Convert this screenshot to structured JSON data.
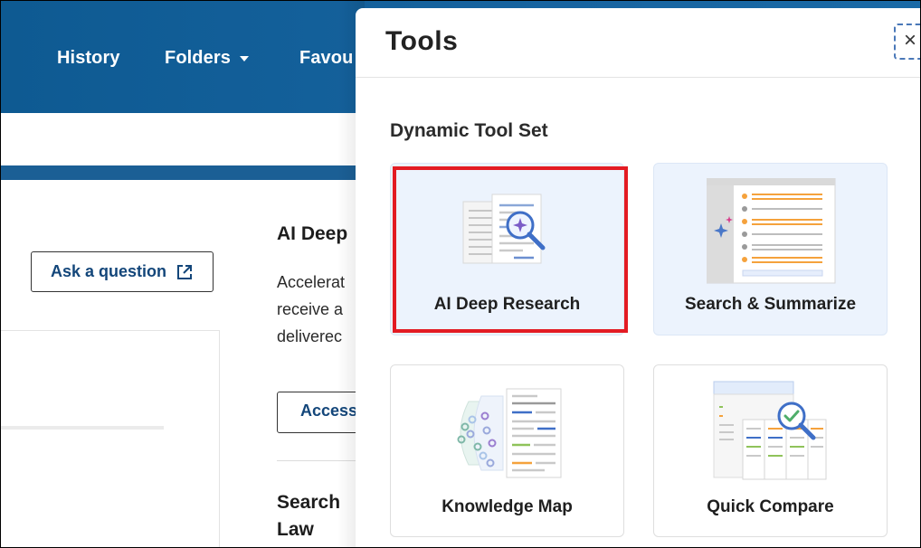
{
  "nav": {
    "history": "History",
    "folders": "Folders",
    "favourites": "Favou"
  },
  "background": {
    "ask_button": "Ask a question",
    "ai_deep_heading": "AI Deep",
    "ai_deep_lines": [
      "Accelerat",
      "receive a",
      "deliverec"
    ],
    "access_button": "Access",
    "search_heading_1": "Search",
    "search_heading_2": "Law"
  },
  "panel": {
    "title": "Tools",
    "close_symbol": "×",
    "section_label": "Dynamic Tool Set",
    "tools": [
      {
        "label": "AI Deep Research",
        "icon": "ai-deep-research-illustration",
        "selected": true
      },
      {
        "label": "Search & Summarize",
        "icon": "search-summarize-illustration",
        "selected": false
      },
      {
        "label": "Knowledge Map",
        "icon": "knowledge-map-illustration",
        "selected": false
      },
      {
        "label": "Quick Compare",
        "icon": "quick-compare-illustration",
        "selected": false
      }
    ]
  },
  "colors": {
    "header_blue": "#0e5a92",
    "link_blue": "#13467a",
    "highlight_red": "#e31b23",
    "tile_tint": "#ecf3fd",
    "accent_orange": "#f5a23c"
  }
}
